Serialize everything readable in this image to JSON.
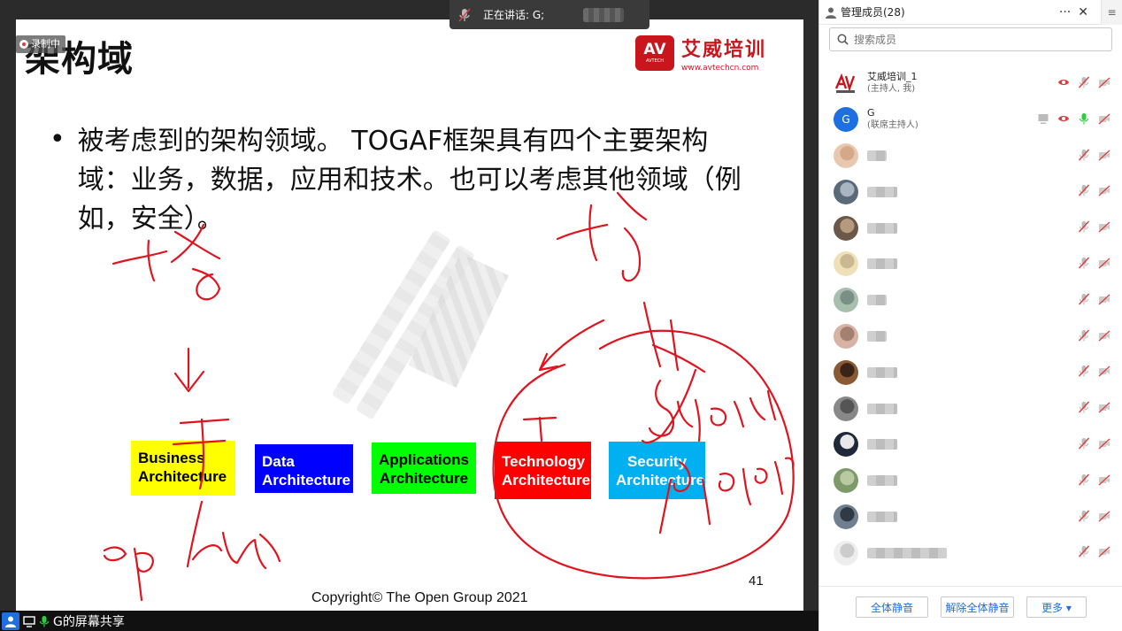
{
  "slide": {
    "title": "架构域",
    "recording_label": "录制中",
    "logo_mark": "AV",
    "logo_mark_sub": "AVTECH",
    "logo_name": "艾威培训",
    "logo_url": "www.avtechcn.com",
    "bullet": "被考虑到的架构领域。 TOGAF框架具有四个主要架构域：业务，数据，应用和技术。也可以考虑其他领域（例如，安全）。",
    "boxes": {
      "business": [
        "Business",
        "Architecture"
      ],
      "data": [
        "Data",
        "Architecture"
      ],
      "applications": [
        "Applications",
        "Architecture"
      ],
      "technology": [
        "Technology",
        "Architecture"
      ],
      "security": [
        "Security",
        "Architecture"
      ]
    },
    "box_colors": {
      "business": "#ffff00",
      "data": "#0000ff",
      "applications": "#00ff00",
      "technology": "#ff0000",
      "security": "#00b0f0"
    },
    "copyright": "Copyright© The Open Group 2021",
    "page_number": "41"
  },
  "speaking_indicator": {
    "label": "正在讲话: G;"
  },
  "share_bar": {
    "label": "G的屏幕共享"
  },
  "members_panel": {
    "title": "管理成员(28)",
    "more_label": "···",
    "close_label": "✕",
    "side_label": "≡",
    "search_placeholder": "搜索成员",
    "members": [
      {
        "name": "艾威培训_1",
        "role": "(主持人, 我)",
        "avatar": "logo",
        "icons": [
          "camera-on",
          "mic-muted",
          "video-off"
        ]
      },
      {
        "name": "G",
        "role": "(联席主持人)",
        "avatar": "G",
        "icons": [
          "screen-share",
          "camera-on",
          "mic-active",
          "video-off"
        ]
      },
      {
        "avatar": "photo",
        "icons": [
          "mic-muted",
          "video-off"
        ]
      },
      {
        "avatar": "photo",
        "icons": [
          "mic-muted",
          "video-off"
        ]
      },
      {
        "avatar": "photo",
        "icons": [
          "mic-muted",
          "video-off"
        ]
      },
      {
        "avatar": "photo",
        "icons": [
          "mic-muted",
          "video-off"
        ]
      },
      {
        "avatar": "photo",
        "icons": [
          "mic-muted",
          "video-off"
        ]
      },
      {
        "avatar": "photo",
        "icons": [
          "mic-muted",
          "video-off"
        ]
      },
      {
        "avatar": "photo",
        "icons": [
          "mic-muted",
          "video-off"
        ]
      },
      {
        "avatar": "photo",
        "icons": [
          "mic-muted",
          "video-off"
        ]
      },
      {
        "avatar": "photo",
        "icons": [
          "mic-muted",
          "video-off"
        ]
      },
      {
        "avatar": "photo",
        "icons": [
          "mic-muted",
          "video-off"
        ]
      },
      {
        "avatar": "photo",
        "icons": [
          "mic-muted",
          "video-off"
        ]
      },
      {
        "avatar": "photo",
        "icons": [
          "mic-muted",
          "video-off"
        ]
      }
    ],
    "buttons": {
      "mute_all": "全体静音",
      "unmute_all": "解除全体静音",
      "more": "更多 ▾"
    }
  },
  "colors": {
    "accent_blue": "#1e6fe0",
    "ink_red": "#e0141e",
    "brand_red": "#c9161d",
    "mic_green": "#2ecc40"
  }
}
